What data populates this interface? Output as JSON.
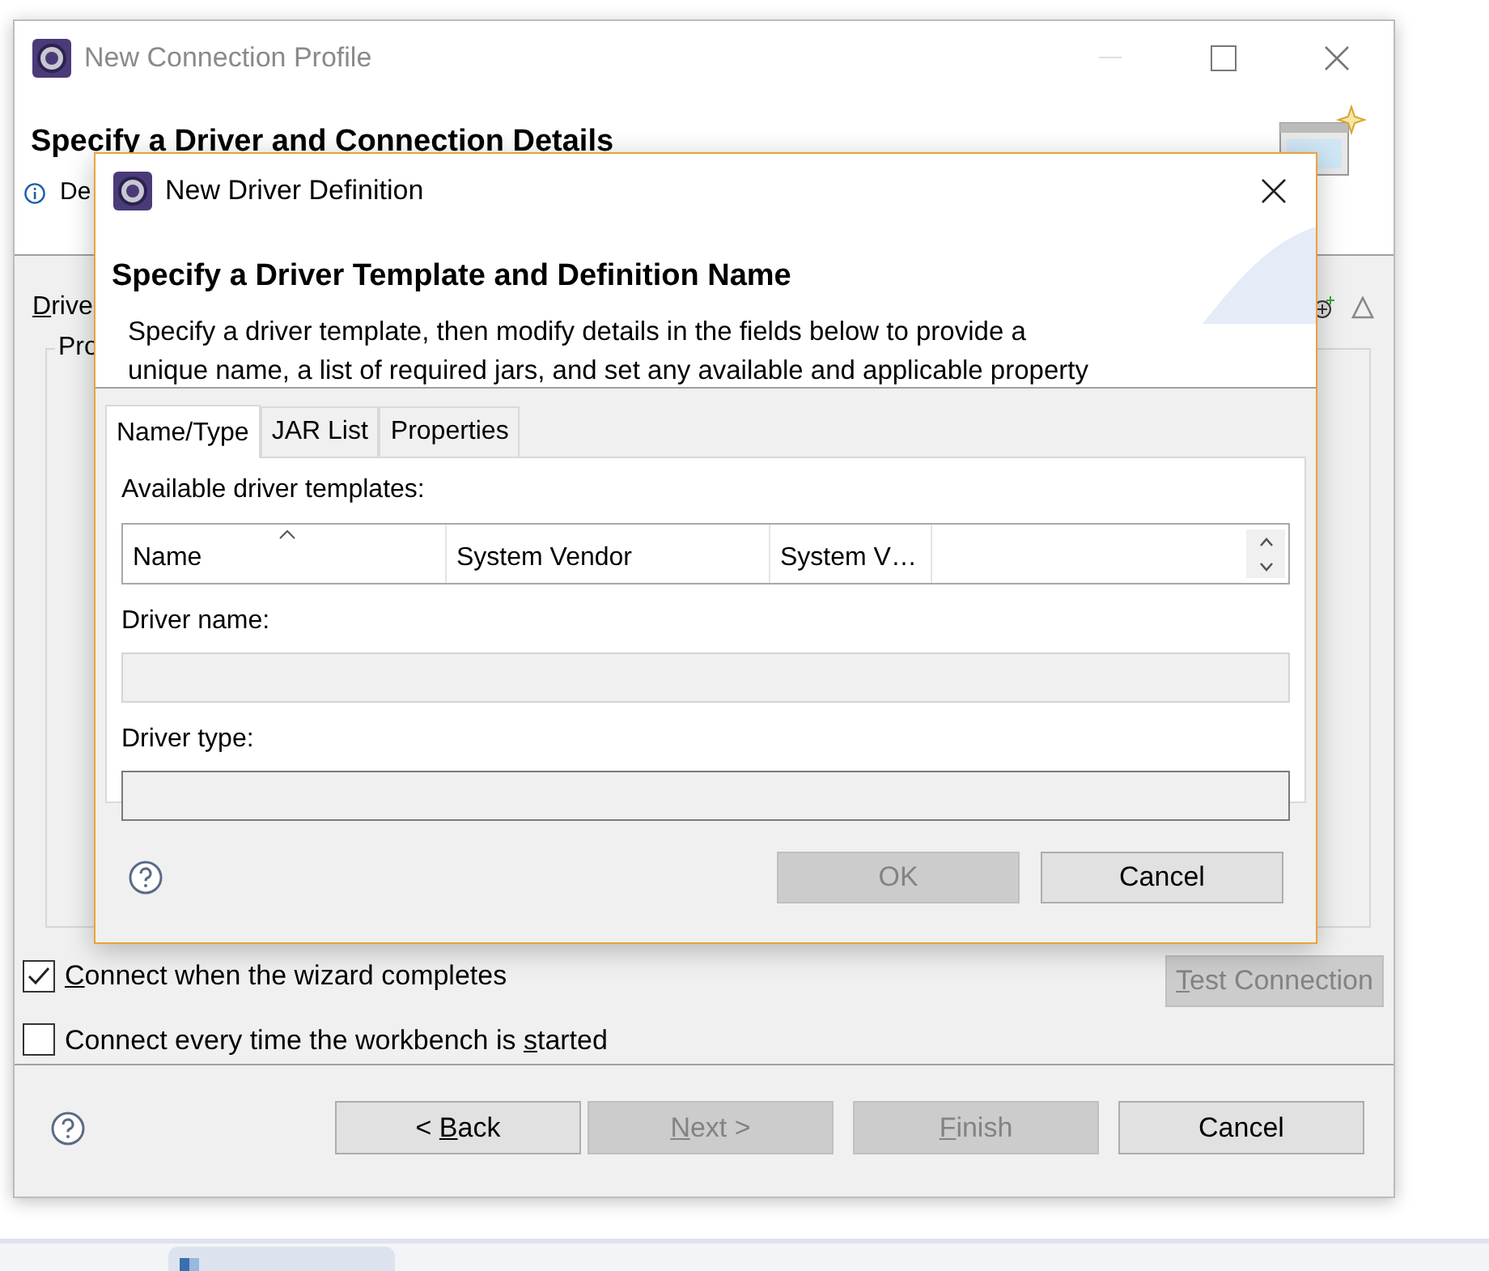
{
  "main_window": {
    "title": "New Connection Profile",
    "header_title": "Specify a Driver and Connection Details",
    "header_message": "De",
    "driver_label": {
      "key": "D",
      "post": "rive"
    },
    "group_label": "Pro",
    "options": [
      {
        "label_parts": {
          "key": "C",
          "post": "onnect when the wizard completes"
        },
        "checked": true
      },
      {
        "label_parts": {
          "pre": "Connect every time the workbench is ",
          "key": "s",
          "post": "tarted"
        },
        "checked": false
      }
    ],
    "test_button": {
      "label_parts": {
        "key": "T",
        "post": "est Connection"
      },
      "disabled": true
    },
    "buttons": [
      {
        "label_parts": {
          "pre": "< ",
          "key": "B",
          "post": "ack"
        },
        "disabled": false
      },
      {
        "label_parts": {
          "key": "N",
          "post": "ext >"
        },
        "disabled": true
      },
      {
        "label_parts": {
          "key": "F",
          "post": "inish"
        },
        "disabled": true
      },
      {
        "label_parts": {
          "pre": "Cancel"
        },
        "disabled": false
      }
    ]
  },
  "dialog": {
    "title": "New Driver Definition",
    "header_title": "Specify a Driver Template and Definition Name",
    "description": [
      "Specify a driver template, then modify details in the fields below to provide a",
      "unique name, a list of required jars, and set any available and applicable property"
    ],
    "tabs": [
      {
        "label": "Name/Type",
        "selected": true
      },
      {
        "label": "JAR List",
        "selected": false
      },
      {
        "label": "Properties",
        "selected": false
      }
    ],
    "templates_label": "Available driver templates:",
    "columns": [
      {
        "label": "Name",
        "sorted": true
      },
      {
        "label": "System Vendor",
        "sorted": false
      },
      {
        "label": "System V…",
        "sorted": false
      }
    ],
    "fields": [
      {
        "label": "Driver name:",
        "disabled": true
      },
      {
        "label": "Driver type:",
        "disabled": false
      }
    ],
    "buttons": [
      {
        "label": "OK",
        "disabled": true
      },
      {
        "label": "Cancel",
        "disabled": false
      }
    ]
  }
}
